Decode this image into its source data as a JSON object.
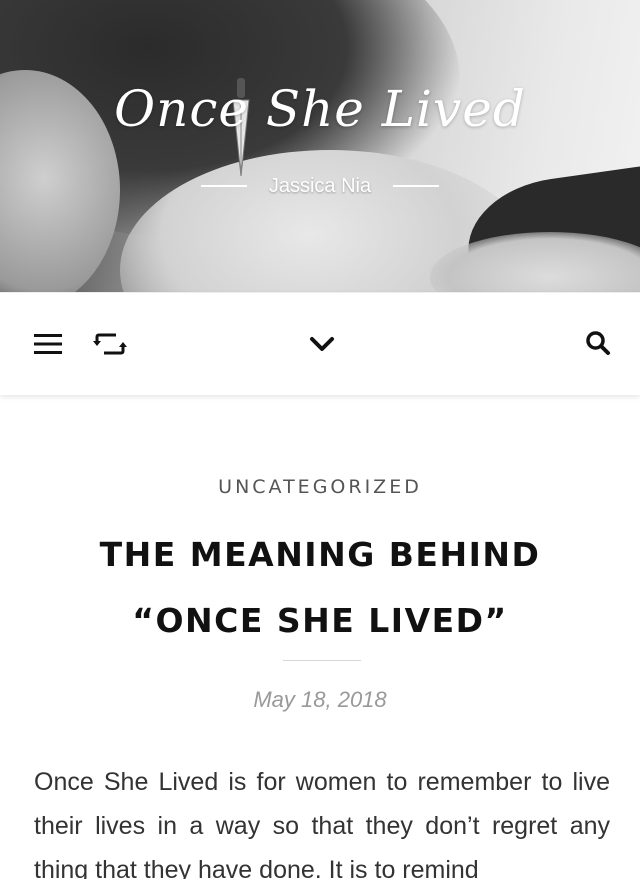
{
  "header": {
    "site_title": "Once She Lived",
    "tagline": "Jassica Nia"
  },
  "nav": {
    "icons": [
      "menu-icon",
      "repost-icon",
      "chevron-down-icon",
      "search-icon"
    ]
  },
  "post": {
    "category": "UNCATEGORIZED",
    "title": "THE MEANING BEHIND “ONCE SHE LIVED”",
    "date": "May 18, 2018",
    "excerpt": "Once She Lived is for women to remember to live their lives in a way so that they don’t regret any thing that they have done. It is to remind"
  },
  "colors": {
    "accent_text": "#111111",
    "muted_text": "#999999",
    "category_text": "#555555"
  }
}
